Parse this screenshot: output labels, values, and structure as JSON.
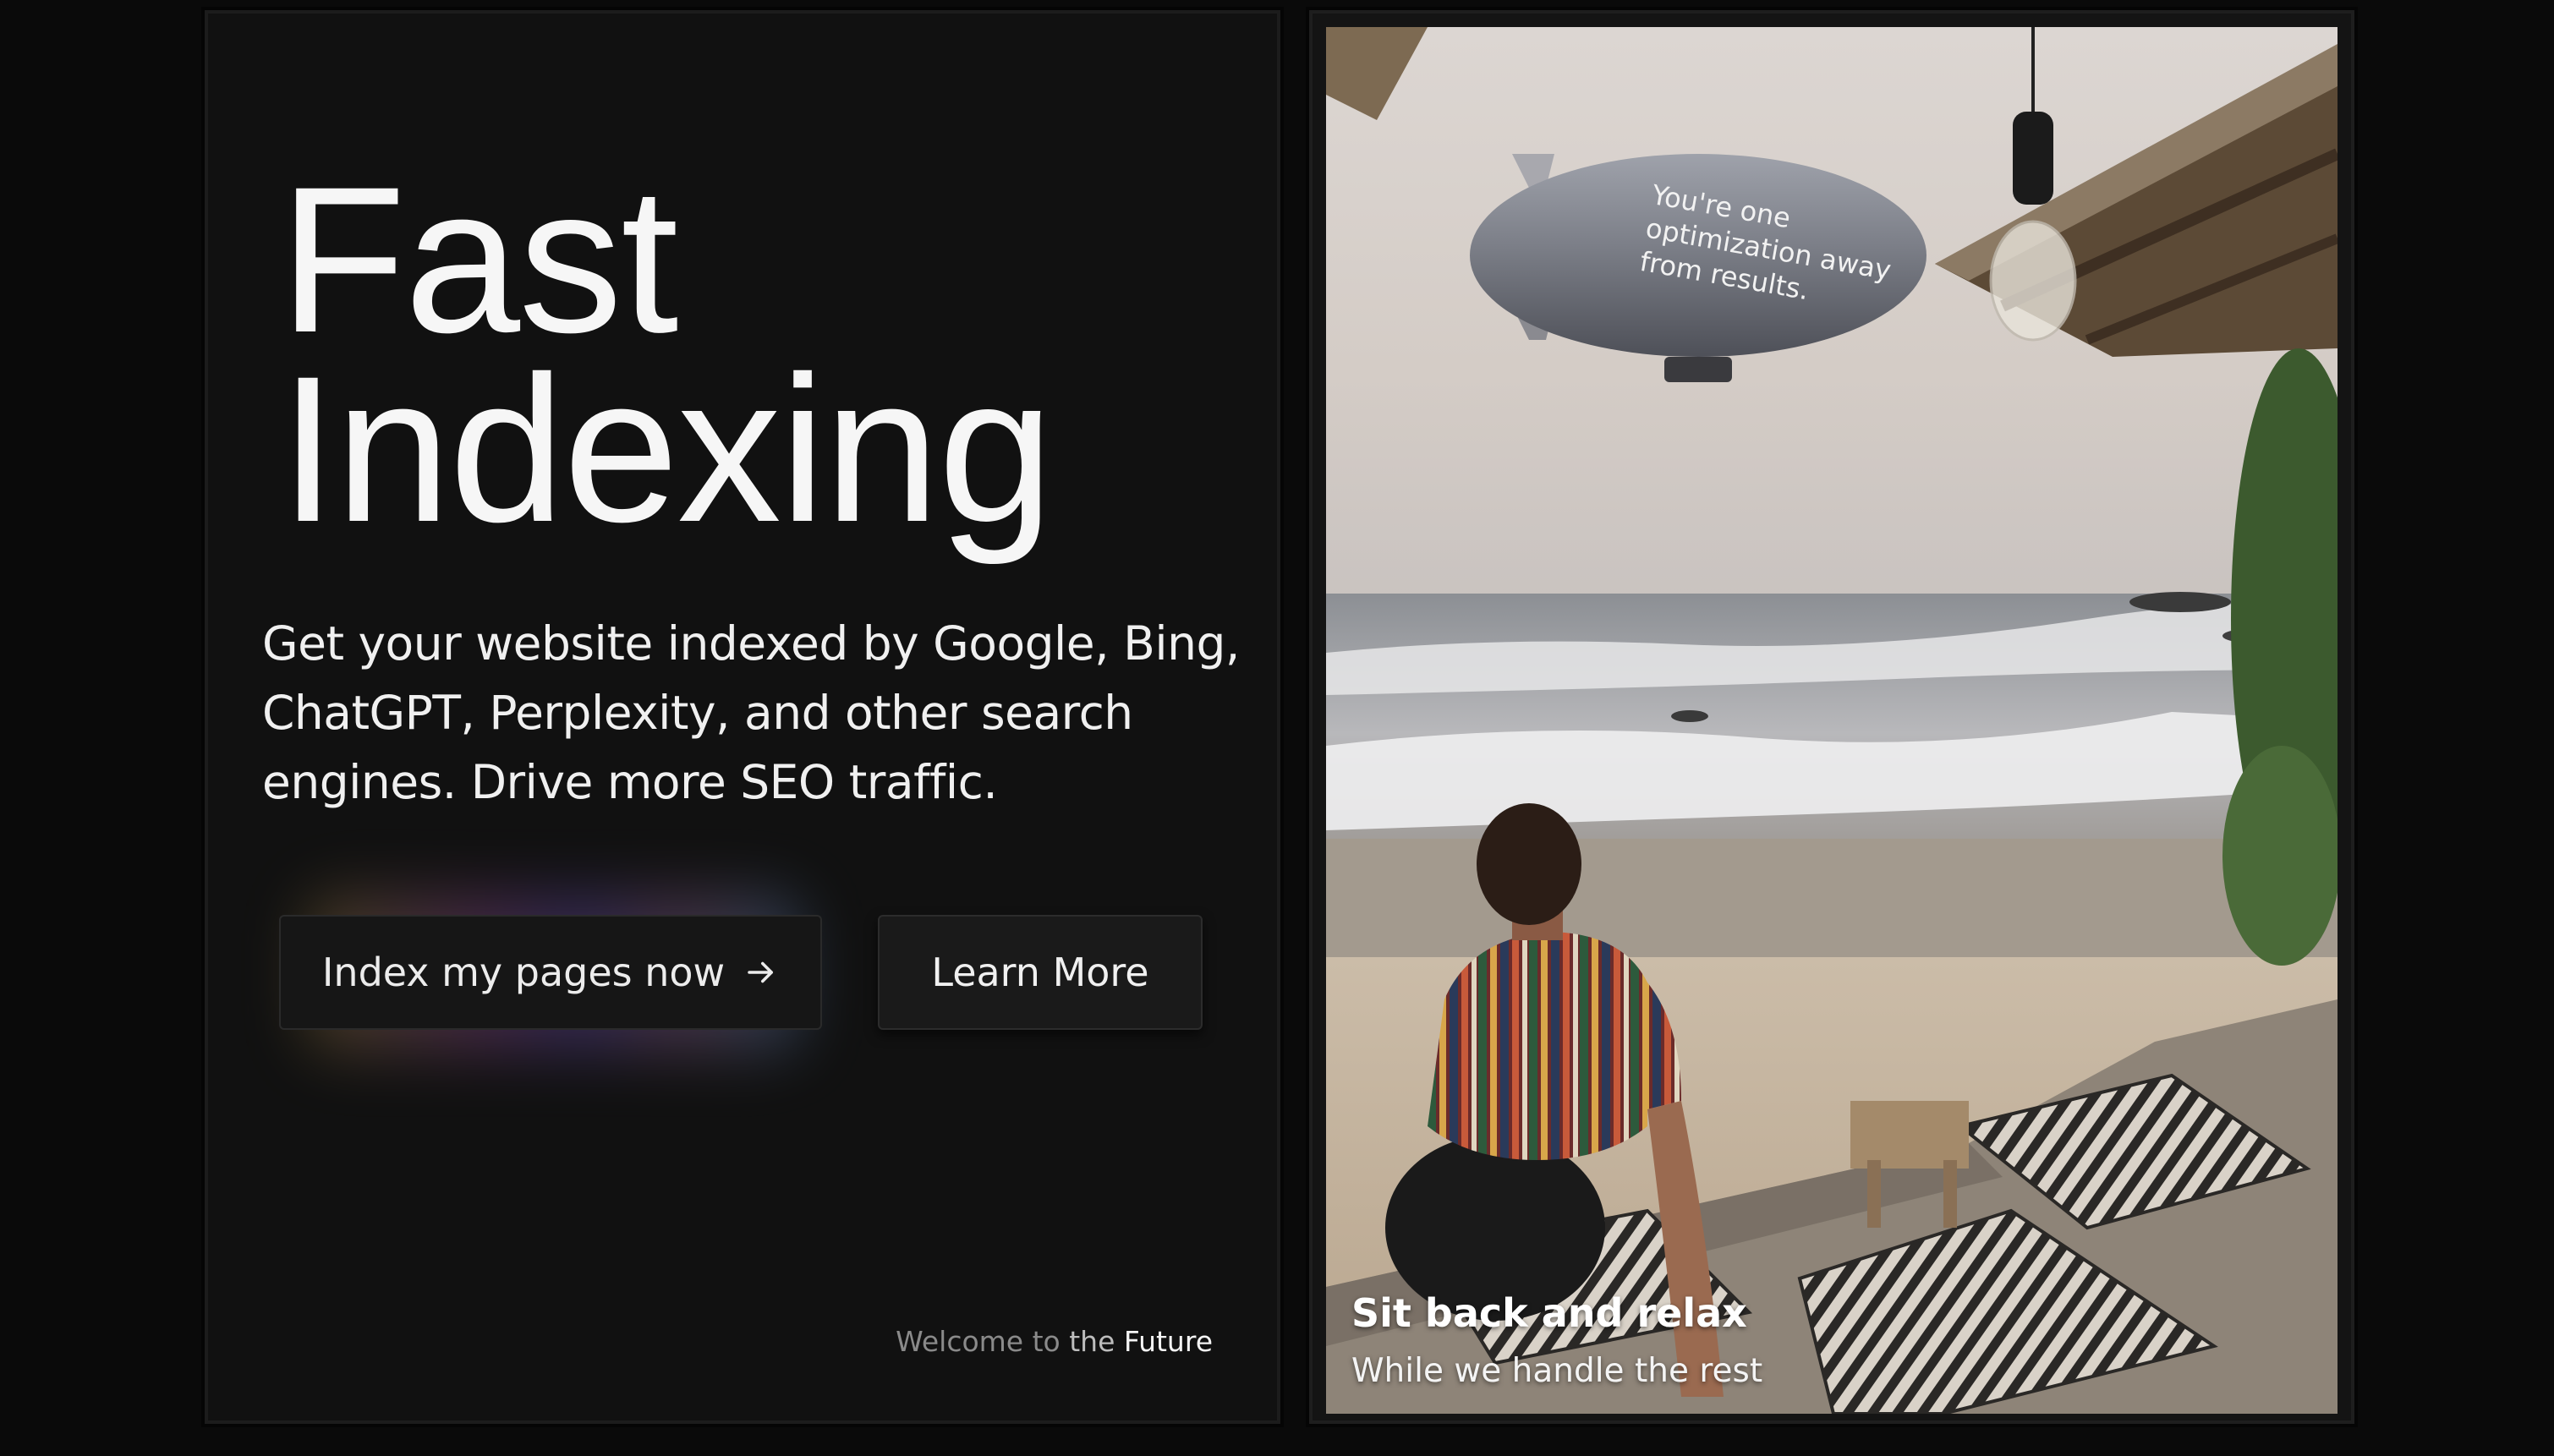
{
  "hero": {
    "title_line1": "Fast",
    "title_line2": "Indexing",
    "description": "Get your website indexed by Google, Bing, ChatGPT, Perplexity, and other search engines. Drive more SEO traffic."
  },
  "buttons": {
    "primary_label": "Index my pages now",
    "primary_icon": "arrow-right-icon",
    "secondary_label": "Learn More"
  },
  "tagline": {
    "welcome": "Welcome to",
    "the": "the",
    "future": "Future"
  },
  "photo": {
    "blimp_text_line1": "You're one",
    "blimp_text_line2": "optimization away",
    "blimp_text_line3": "from results.",
    "caption_title": "Sit back and relax",
    "caption_subtitle": "While we handle the rest"
  },
  "colors": {
    "background": "#0a0a0a",
    "panel": "#111111",
    "button": "#161616",
    "text": "#f2f2f2",
    "muted": "#8a8a8a"
  }
}
